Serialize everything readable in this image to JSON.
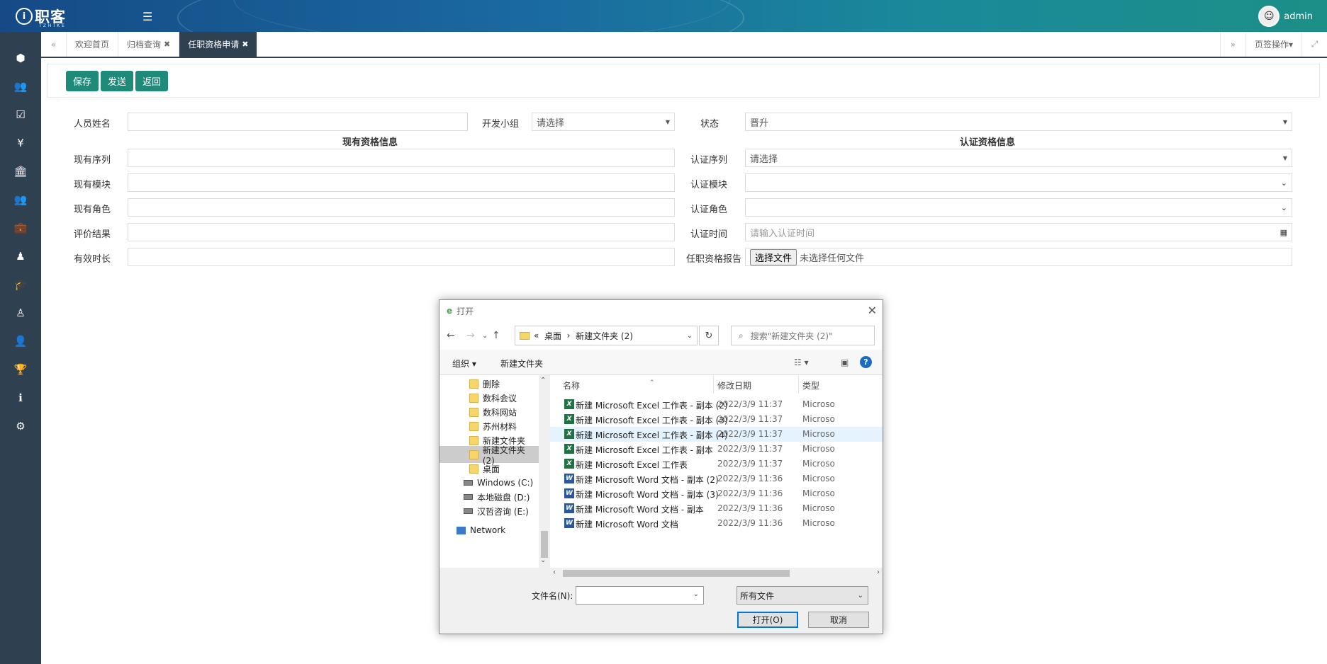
{
  "app": {
    "logo_text": "职客",
    "logo_sub": "IZHIKE",
    "user": "admin"
  },
  "tabs": [
    {
      "label": "欢迎首页"
    },
    {
      "label": "归档查询",
      "closable": true
    },
    {
      "label": "任职资格申请",
      "closable": true,
      "active": true
    }
  ],
  "page_ops": "页签操作",
  "toolbar": {
    "save": "保存",
    "send": "发送",
    "back": "返回"
  },
  "form": {
    "name_label": "人员姓名",
    "name_value": "",
    "group_label": "开发小组",
    "group_value": "请选择",
    "status_label": "状态",
    "status_value": "晋升",
    "current_title": "现有资格信息",
    "cert_title": "认证资格信息",
    "cur_seq_label": "现有序列",
    "cur_mod_label": "现有模块",
    "cur_role_label": "现有角色",
    "eval_label": "评价结果",
    "valid_label": "有效时长",
    "cert_seq_label": "认证序列",
    "cert_seq_value": "请选择",
    "cert_mod_label": "认证模块",
    "cert_role_label": "认证角色",
    "cert_time_label": "认证时间",
    "cert_time_placeholder": "请输入认证时间",
    "report_label": "任职资格报告",
    "file_button": "选择文件",
    "file_status": "未选择任何文件"
  },
  "dialog": {
    "title": "打开",
    "address": {
      "prefix": "«",
      "crumb1": "桌面",
      "sep": "›",
      "crumb2": "新建文件夹 (2)"
    },
    "search_placeholder": "搜索\"新建文件夹 (2)\"",
    "organize": "组织 ▾",
    "new_folder": "新建文件夹",
    "tree": [
      {
        "label": "删除",
        "type": "folder"
      },
      {
        "label": "数科会议",
        "type": "folder"
      },
      {
        "label": "数科网站",
        "type": "folder"
      },
      {
        "label": "苏州材料",
        "type": "folder"
      },
      {
        "label": "新建文件夹",
        "type": "folder"
      },
      {
        "label": "新建文件夹 (2)",
        "type": "folder",
        "selected": true
      },
      {
        "label": "桌面",
        "type": "folder"
      },
      {
        "label": "Windows (C:)",
        "type": "drive"
      },
      {
        "label": "本地磁盘 (D:)",
        "type": "drive"
      },
      {
        "label": "汉哲咨询 (E:)",
        "type": "drive"
      },
      {
        "label": "Network",
        "type": "network"
      }
    ],
    "columns": {
      "name": "名称",
      "date": "修改日期",
      "type": "类型"
    },
    "files": [
      {
        "name": "新建 Microsoft Excel 工作表 - 副本 (2)",
        "date": "2022/3/9 11:37",
        "type": "Microso",
        "kind": "xl"
      },
      {
        "name": "新建 Microsoft Excel 工作表 - 副本 (3)",
        "date": "2022/3/9 11:37",
        "type": "Microso",
        "kind": "xl"
      },
      {
        "name": "新建 Microsoft Excel 工作表 - 副本 (4)",
        "date": "2022/3/9 11:37",
        "type": "Microso",
        "kind": "xl",
        "highlight": true
      },
      {
        "name": "新建 Microsoft Excel 工作表 - 副本",
        "date": "2022/3/9 11:37",
        "type": "Microso",
        "kind": "xl"
      },
      {
        "name": "新建 Microsoft Excel 工作表",
        "date": "2022/3/9 11:37",
        "type": "Microso",
        "kind": "xl"
      },
      {
        "name": "新建 Microsoft Word 文档 - 副本 (2)",
        "date": "2022/3/9 11:36",
        "type": "Microso",
        "kind": "wd"
      },
      {
        "name": "新建 Microsoft Word 文档 - 副本 (3)",
        "date": "2022/3/9 11:36",
        "type": "Microso",
        "kind": "wd"
      },
      {
        "name": "新建 Microsoft Word 文档 - 副本",
        "date": "2022/3/9 11:36",
        "type": "Microso",
        "kind": "wd"
      },
      {
        "name": "新建 Microsoft Word 文档",
        "date": "2022/3/9 11:36",
        "type": "Microso",
        "kind": "wd"
      }
    ],
    "filename_label": "文件名(N):",
    "filename_value": "",
    "filetype_value": "所有文件",
    "open_button": "打开(O)",
    "cancel_button": "取消"
  }
}
